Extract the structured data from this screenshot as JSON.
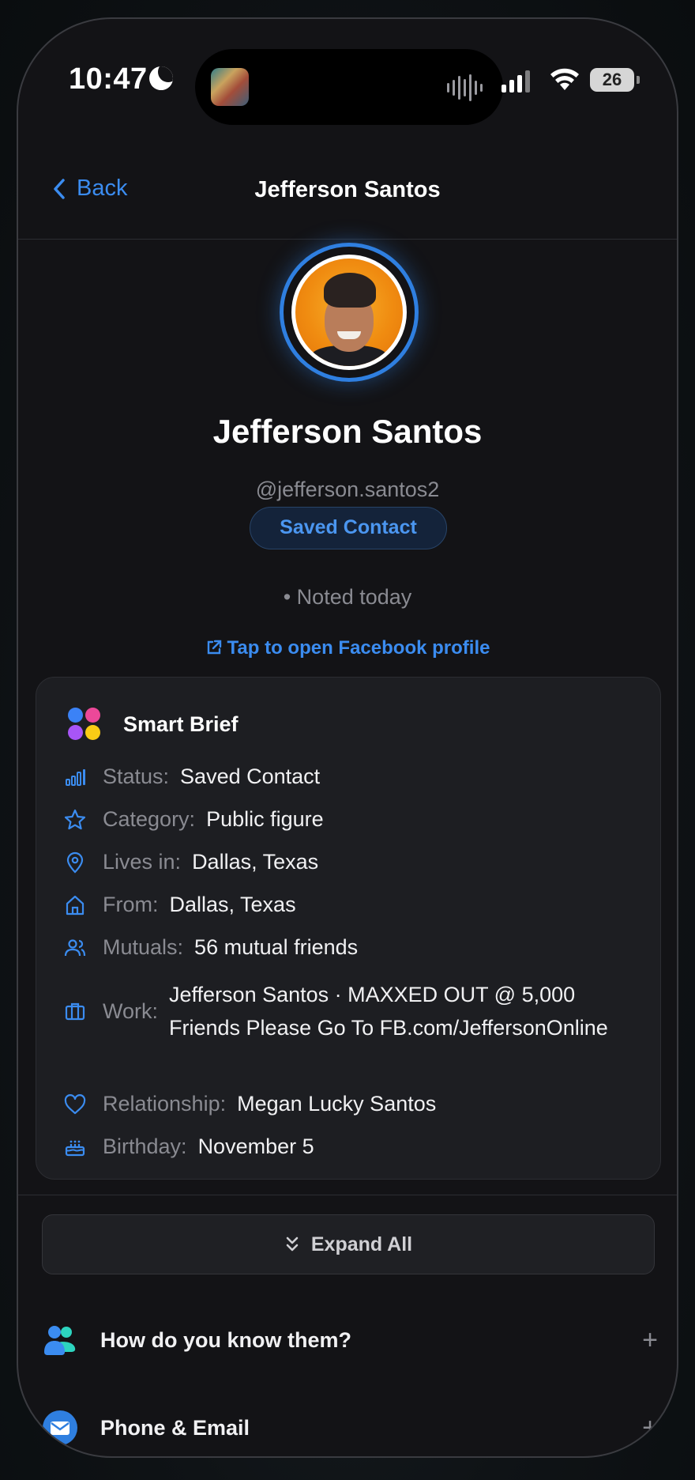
{
  "status_bar": {
    "time": "10:47",
    "battery": "26"
  },
  "nav": {
    "back_label": "Back",
    "title": "Jefferson Santos"
  },
  "profile": {
    "name": "Jefferson Santos",
    "handle": "@jefferson.santos2",
    "badge": "Saved Contact",
    "noted": "• Noted today",
    "fb_link": "Tap to open Facebook profile"
  },
  "smart_brief": {
    "title": "Smart Brief",
    "rows": [
      {
        "icon": "signal-bars-icon",
        "label": "Status:",
        "value": "Saved Contact"
      },
      {
        "icon": "star-icon",
        "label": "Category:",
        "value": "Public figure"
      },
      {
        "icon": "location-pin-icon",
        "label": "Lives in:",
        "value": "Dallas, Texas"
      },
      {
        "icon": "home-icon",
        "label": "From:",
        "value": "Dallas, Texas"
      },
      {
        "icon": "users-icon",
        "label": "Mutuals:",
        "value": "56 mutual friends"
      },
      {
        "icon": "briefcase-icon",
        "label": "Work:",
        "value": "Jefferson Santos · MAXXED OUT @ 5,000 Friends Please Go To FB.com/JeffersonOnline"
      },
      {
        "icon": "heart-icon",
        "label": "Relationship:",
        "value": "Megan Lucky Santos"
      },
      {
        "icon": "cake-icon",
        "label": "Birthday:",
        "value": "November 5"
      }
    ]
  },
  "expand_all": "Expand All",
  "sections": [
    {
      "icon": "people-icon",
      "title": "How do you know them?",
      "action": "+"
    },
    {
      "icon": "mail-icon",
      "title": "Phone & Email",
      "action": "+"
    }
  ],
  "colors": {
    "accent": "#3b8cf0",
    "background": "#131316",
    "card": "#1d1e22",
    "muted": "#8a8b92"
  }
}
